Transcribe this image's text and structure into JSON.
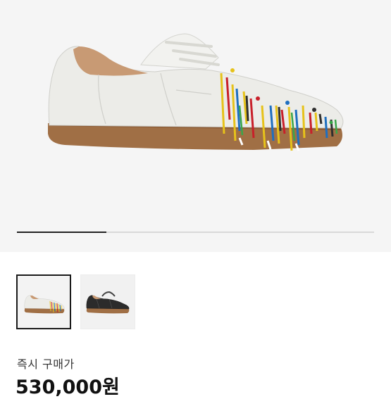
{
  "product": {
    "gallery": {
      "image_alt": "paint-splatter-sneaker",
      "progress_fraction": 0.25,
      "thumbnails": [
        {
          "name": "white-paint-splatter",
          "selected": true
        },
        {
          "name": "black-leather",
          "selected": false
        }
      ]
    },
    "purchase_label": "즉시 구매가",
    "price": "530,000원"
  },
  "colors": {
    "hero_background": "#f5f5f5",
    "gum_sole": "#a06f45",
    "leather_white": "#eeeeea",
    "leather_black": "#2b2b2b"
  }
}
